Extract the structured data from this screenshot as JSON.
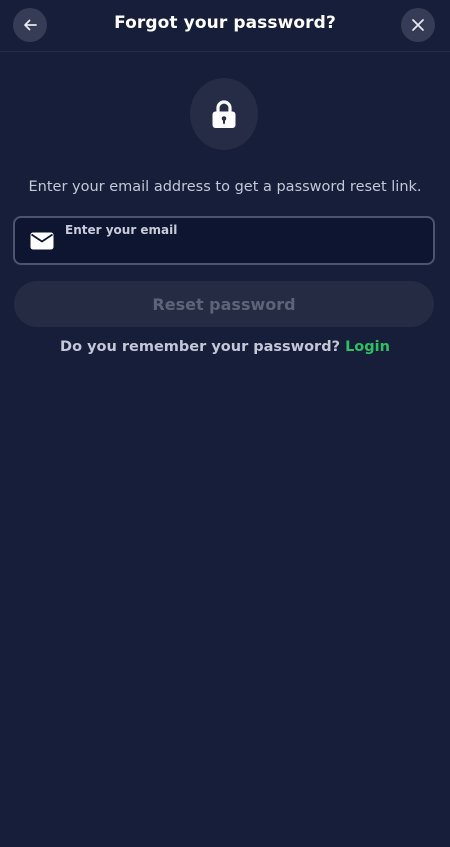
{
  "header": {
    "title": "Forgot your password?",
    "back_icon": "arrow-left-icon",
    "close_icon": "close-icon"
  },
  "hero": {
    "icon": "lock-icon"
  },
  "instructions": "Enter your email address to get a password reset link.",
  "email_field": {
    "label": "Enter your email",
    "value": "",
    "icon": "envelope-icon"
  },
  "reset_button": {
    "label": "Reset password",
    "disabled": true
  },
  "footer": {
    "question": "Do you remember your password?",
    "login_label": "Login"
  },
  "colors": {
    "background": "#171e3a",
    "accent": "#2ec061",
    "button_disabled_bg": "#252b43",
    "button_disabled_text": "#5e6478"
  }
}
